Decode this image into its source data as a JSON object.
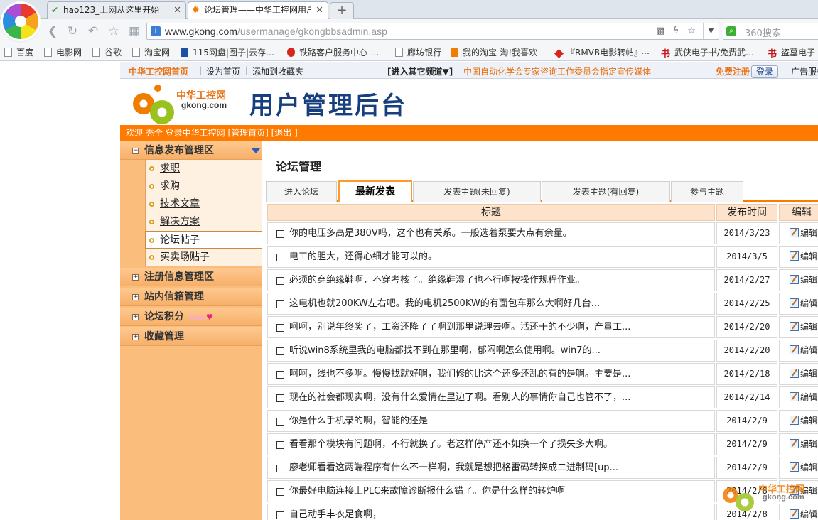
{
  "browser": {
    "tabs": [
      {
        "title": "hao123_上网从这里开始"
      },
      {
        "title": "论坛管理——中华工控网用户"
      }
    ],
    "url_host": "www.gkong.com",
    "url_path": "/usermanage/gkongbbsadmin.asp",
    "search_placeholder": "360搜索",
    "bookmarks": [
      {
        "label": "百度"
      },
      {
        "label": "电影网"
      },
      {
        "label": "谷歌"
      },
      {
        "label": "淘宝网"
      },
      {
        "label": "115网盘|圈子|云存…"
      },
      {
        "label": "铁路客户服务中心-…"
      },
      {
        "label": "廊坊银行"
      },
      {
        "label": "我的淘宝-淘!我喜欢"
      },
      {
        "label": "『RMVB电影转帖』"
      },
      {
        "label": "…"
      },
      {
        "label": "武侠电子书/免费武…"
      },
      {
        "label": "盗墓电子"
      }
    ]
  },
  "topstrip": {
    "home": "中华工控网首页",
    "set_home": "设为首页",
    "add_fav": "添加到收藏夹",
    "channels": "[进入其它频道▼]",
    "slogan": "中国自动化学会专家咨询工作委员会指定宣传媒体",
    "register": "免费注册",
    "login": "登录",
    "ad": "广告服务"
  },
  "header": {
    "logo_cn": "中华工控网",
    "logo_en": "gkong.com",
    "title": "用户管理后台"
  },
  "welcome": "欢迎 秃全 登录中华工控网 [管理首页] [退出 ]",
  "sidebar": {
    "section1": "信息发布管理区",
    "subitems": [
      "求职",
      "求购",
      "技术文章",
      "解决方案",
      "论坛帖子",
      "买卖场贴子"
    ],
    "section2": "注册信息管理区",
    "section3": "站内信箱管理",
    "section4": "论坛积分",
    "section5": "收藏管理",
    "heart_text": "New"
  },
  "content": {
    "title": "论坛管理",
    "tabs": [
      "进入论坛",
      "最新发表",
      "发表主题(未回复)",
      "发表主题(有回复)",
      "参与主题"
    ],
    "columns": {
      "title": "标题",
      "date": "发布时间",
      "edit": "编辑"
    },
    "edit_label": "编辑",
    "rows": [
      {
        "title": "你的电压多高是380V吗，这个也有关系。一般选着泵要大点有余量。",
        "date": "2014/3/23"
      },
      {
        "title": "电工的胆大，还得心细才能可以的。",
        "date": "2014/3/5"
      },
      {
        "title": "必须的穿绝缘鞋啊，不穿考核了。绝缘鞋湿了也不行啊按操作规程作业。",
        "date": "2014/2/27"
      },
      {
        "title": "这电机也就200KW左右吧。我的电机2500KW的有面包车那么大啊好几台...",
        "date": "2014/2/25"
      },
      {
        "title": "呵呵，别说年终奖了，工资还降了了啊到那里说理去啊。活还干的不少啊，产量工...",
        "date": "2014/2/20"
      },
      {
        "title": "听说win8系统里我的电脑都找不到在那里啊，郁闷啊怎么使用啊。win7的...",
        "date": "2014/2/20"
      },
      {
        "title": "呵呵，线也不多啊。慢慢找就好啊，我们修的比这个还多还乱的有的是啊。主要是...",
        "date": "2014/2/18"
      },
      {
        "title": "现在的社会都现实啊，没有什么爱情在里边了啊。看别人的事情你自己也管不了，...",
        "date": "2014/2/14"
      },
      {
        "title": "你是什么手机录的啊，智能的还是",
        "date": "2014/2/9"
      },
      {
        "title": "看看那个模块有问题啊，不行就换了。老这样停产还不如换一个了损失多大啊。",
        "date": "2014/2/9"
      },
      {
        "title": "廖老师看看这两端程序有什么不一样啊，我就是想把格雷码转换成二进制码[up...",
        "date": "2014/2/9"
      },
      {
        "title": "你最好电脑连接上PLC来故障诊断报什么错了。你是什么样的转炉啊",
        "date": "2014/2/8"
      },
      {
        "title": "自己动手丰衣足食啊，",
        "date": "2014/2/8"
      }
    ]
  },
  "watermark": {
    "cn": "中华工控网",
    "en": "gkong.com"
  }
}
